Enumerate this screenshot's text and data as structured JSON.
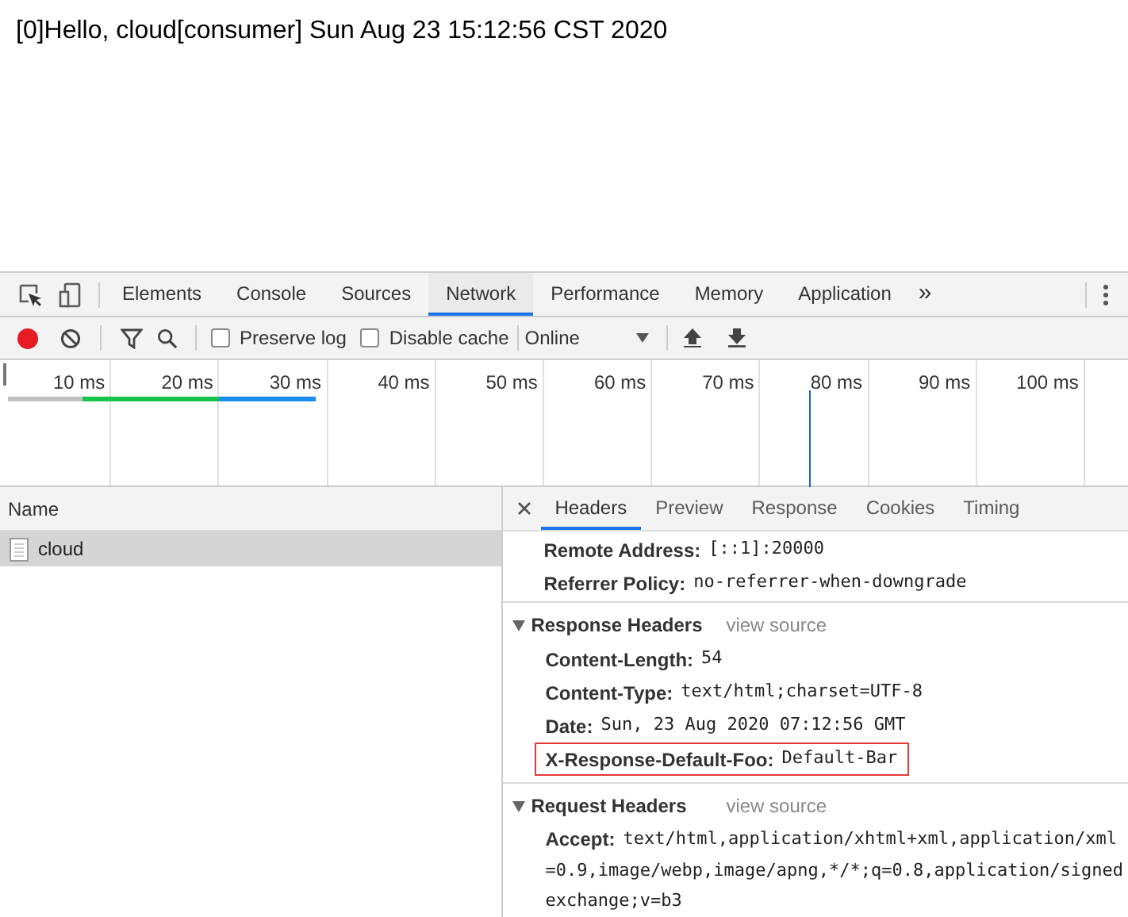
{
  "page": {
    "text": "[0]Hello, cloud[consumer] Sun Aug 23 15:12:56 CST 2020"
  },
  "devtools_tabs": [
    {
      "label": "Elements",
      "selected": false
    },
    {
      "label": "Console",
      "selected": false
    },
    {
      "label": "Sources",
      "selected": false
    },
    {
      "label": "Network",
      "selected": true
    },
    {
      "label": "Performance",
      "selected": false
    },
    {
      "label": "Memory",
      "selected": false
    },
    {
      "label": "Application",
      "selected": false
    }
  ],
  "more_tabs": "»",
  "toolbar": {
    "recording": true,
    "preserve_log": {
      "label": "Preserve log",
      "checked": false
    },
    "disable_cache": {
      "label": "Disable cache",
      "checked": false
    },
    "throttling": "Online"
  },
  "timeline": {
    "ticks": [
      "10 ms",
      "20 ms",
      "30 ms",
      "40 ms",
      "50 ms",
      "60 ms",
      "70 ms",
      "80 ms",
      "90 ms",
      "100 ms"
    ]
  },
  "requests": {
    "column": "Name",
    "rows": [
      {
        "name": "cloud",
        "selected": true
      }
    ]
  },
  "detail_tabs": [
    {
      "label": "Headers",
      "selected": true
    },
    {
      "label": "Preview",
      "selected": false
    },
    {
      "label": "Response",
      "selected": false
    },
    {
      "label": "Cookies",
      "selected": false
    },
    {
      "label": "Timing",
      "selected": false
    }
  ],
  "general_tail": [
    {
      "name": "Remote Address:",
      "value": "[::1]:20000"
    },
    {
      "name": "Referrer Policy:",
      "value": "no-referrer-when-downgrade"
    }
  ],
  "sections": [
    {
      "title": "Response Headers",
      "expanded": true,
      "link": "view source",
      "headers": [
        {
          "name": "Content-Length:",
          "value": "54",
          "highlighted": false
        },
        {
          "name": "Content-Type:",
          "value": "text/html;charset=UTF-8",
          "highlighted": false
        },
        {
          "name": "Date:",
          "value": "Sun, 23 Aug 2020 07:12:56 GMT",
          "highlighted": false
        },
        {
          "name": "X-Response-Default-Foo:",
          "value": "Default-Bar",
          "highlighted": true
        }
      ]
    },
    {
      "title": "Request Headers",
      "expanded": true,
      "link": "view source",
      "headers": [
        {
          "name": "Accept:",
          "value": "text/html,application/xhtml+xml,application/xml",
          "highlighted": false,
          "continuation": [
            "=0.9,image/webp,image/apng,*/*;q=0.8,application/signed",
            "exchange;v=b3"
          ]
        }
      ]
    }
  ]
}
